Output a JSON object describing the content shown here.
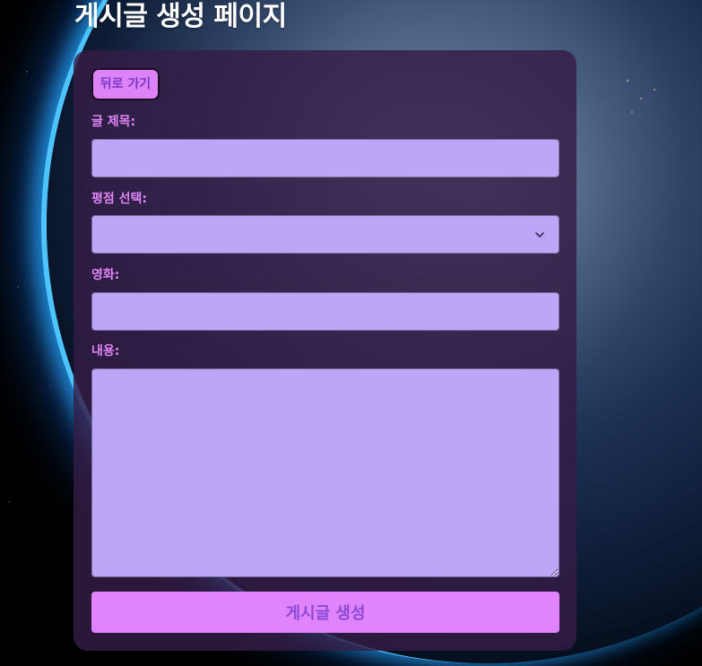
{
  "page": {
    "title": "게시글 생성 페이지"
  },
  "form": {
    "back_label": "뒤로 가기",
    "title_label": "글 제목:",
    "title_value": "",
    "rating_label": "평점 선택:",
    "rating_value": "",
    "movie_label": "영화:",
    "movie_value": "",
    "content_label": "내용:",
    "content_value": "",
    "submit_label": "게시글 생성"
  },
  "colors": {
    "card_bg": "#341c46",
    "label": "#df85f6",
    "input_bg": "#bca6f7",
    "button_bg": "#e083fc",
    "button_text": "#8a4ad6"
  },
  "icons": {
    "select_arrow": "chevron-down-icon",
    "textarea_grip": "resize-grip-icon"
  }
}
